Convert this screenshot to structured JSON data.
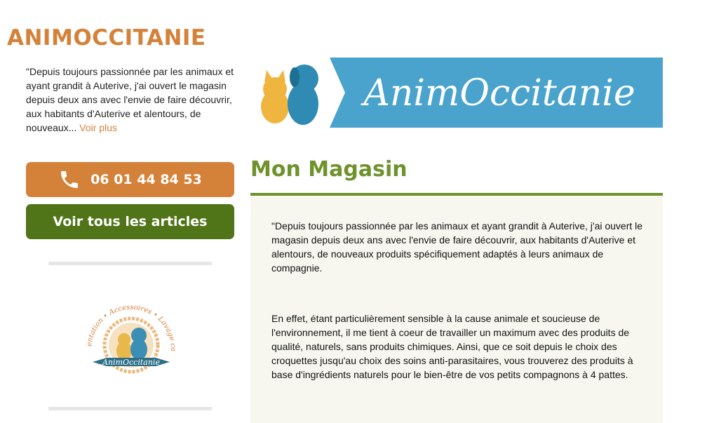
{
  "sidebar": {
    "brand_title": "ANIMOCCITANIE",
    "intro_text": "\"Depuis toujours passionnée par les animaux et ayant grandit à Auterive, j'ai ouvert le magasin depuis deux ans avec l'envie de faire découvrir, aux habitants d'Auterive et alentours, de nouveaux... ",
    "read_more": "Voir plus",
    "phone_label": "06 01 44 84 53",
    "articles_label": "Voir tous les articles",
    "badge": {
      "arc_text": "Alimentation • Accessoires • Lavage canin",
      "ribbon_text": "AnimOccitanie"
    }
  },
  "banner": {
    "logo_text": "AnimOccitanie"
  },
  "main": {
    "section_title": "Mon Magasin",
    "paragraphs": [
      "\"Depuis toujours passionnée par les animaux et ayant grandit à Auterive, j'ai ouvert le magasin depuis deux ans avec l'envie de faire découvrir, aux habitants d'Auterive et alentours, de nouveaux produits spécifiquement adaptés à leurs animaux de compagnie.",
      "En effet, étant particulièrement sensible à la cause animale et soucieuse de l'environnement, il me tient à coeur de travailler un maximum avec des produits de qualité, naturels, sans produits chimiques. Ainsi, que ce soit depuis le choix des croquettes jusqu'au choix des soins anti-parasitaires, vous trouverez des produits à base d'ingrédients naturels pour le bien-être de vos petits compagnons à 4 pattes."
    ]
  },
  "colors": {
    "orange": "#d4823a",
    "dark_green": "#507418",
    "title_green": "#6e922c",
    "banner_blue": "#4aa3cc"
  },
  "icons": {
    "phone": "phone-icon"
  }
}
